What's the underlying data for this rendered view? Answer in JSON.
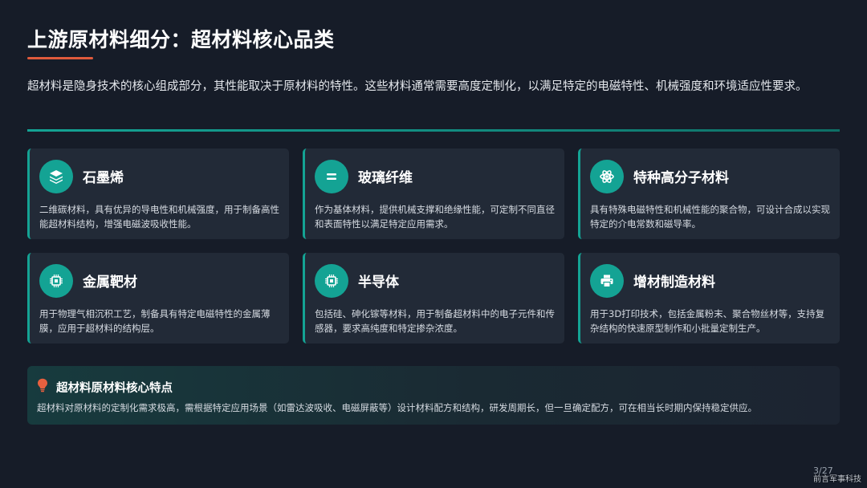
{
  "title": "上游原材料细分：超材料核心品类",
  "intro": "超材料是隐身技术的核心组成部分，其性能取决于原材料的特性。这些材料通常需要高度定制化，以满足特定的电磁特性、机械强度和环境适应性要求。",
  "accent_colors": {
    "teal": "#14a394",
    "title_underline": "#e05a3c",
    "bulb": "#e8603f"
  },
  "cards": [
    {
      "icon": "layers-icon",
      "title": "石墨烯",
      "desc": "二维碳材料，具有优异的导电性和机械强度，用于制备高性能超材料结构，增强电磁波吸收性能。"
    },
    {
      "icon": "equals-icon",
      "title": "玻璃纤维",
      "desc": "作为基体材料，提供机械支撑和绝缘性能，可定制不同直径和表面特性以满足特定应用需求。"
    },
    {
      "icon": "atom-icon",
      "title": "特种高分子材料",
      "desc": "具有特殊电磁特性和机械性能的聚合物，可设计合成以实现特定的介电常数和磁导率。"
    },
    {
      "icon": "chip-icon",
      "title": "金属靶材",
      "desc": "用于物理气相沉积工艺，制备具有特定电磁特性的金属薄膜，应用于超材料的结构层。"
    },
    {
      "icon": "chip-icon",
      "title": "半导体",
      "desc": "包括硅、砷化镓等材料，用于制备超材料中的电子元件和传感器，要求高纯度和特定掺杂浓度。"
    },
    {
      "icon": "printer-icon",
      "title": "增材制造材料",
      "desc": "用于3D打印技术，包括金属粉末、聚合物丝材等，支持复杂结构的快速原型制作和小批量定制生产。"
    }
  ],
  "highlight": {
    "icon": "lightbulb-icon",
    "title": "超材料原材料核心特点",
    "desc": "超材料对原材料的定制化需求极高，需根据特定应用场景（如雷达波吸收、电磁屏蔽等）设计材料配方和结构，研发周期长，但一旦确定配方，可在相当长时期内保持稳定供应。"
  },
  "page_number": "3/27",
  "watermark": "前言军事科技"
}
